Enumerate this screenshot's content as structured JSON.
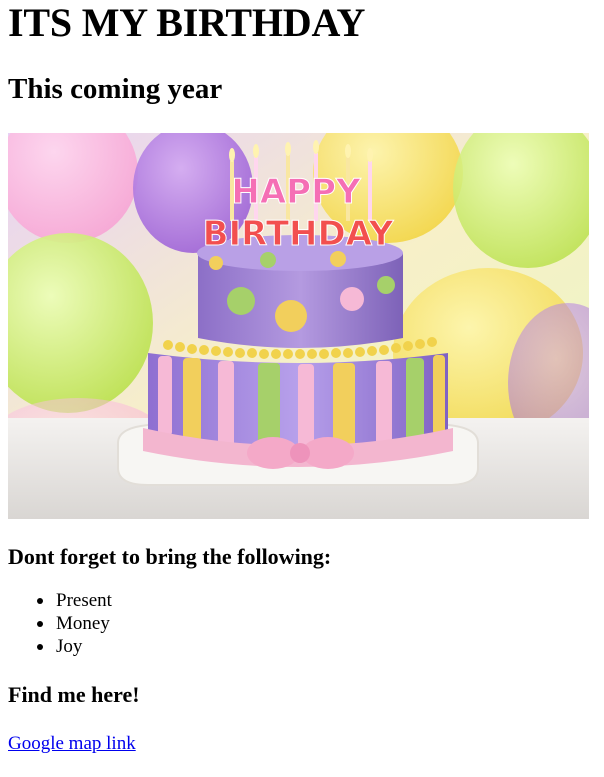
{
  "page": {
    "title": "ITS MY BIRTHDAY",
    "subtitle": "This coming year"
  },
  "hero": {
    "banner_text_1": "HAPPY",
    "banner_text_2": "BIRTHDAY"
  },
  "bring": {
    "heading": "Dont forget to bring the following:",
    "items": [
      "Present",
      "Money",
      "Joy"
    ]
  },
  "find": {
    "heading": "Find me here!",
    "link_text": "Google map link"
  },
  "colors": {
    "link": "#0000ee",
    "cake_top": "#a78bd6",
    "cake_bottom_stripe_yellow": "#f2cf5c",
    "cake_bottom_stripe_green": "#a6d06a",
    "ribbon_pink": "#f3b6cf"
  }
}
